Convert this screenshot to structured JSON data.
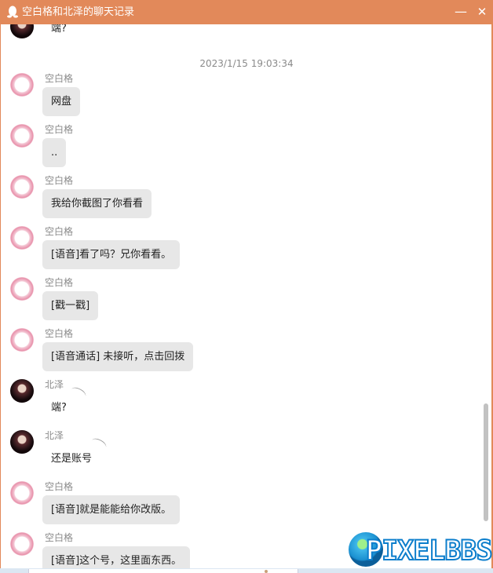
{
  "window": {
    "title": "空白格和北泽的聊天记录",
    "title_icon": "qq-penguin-icon",
    "minimize_label": "—",
    "close_label": "✕",
    "accent_color": "#e2895a"
  },
  "chat": {
    "timestamp": "2023/1/15 19:03:34",
    "top_partial": {
      "text": "端?"
    },
    "messages": [
      {
        "sender": "空白格",
        "text": "网盘",
        "avatar": "pink"
      },
      {
        "sender": "空白格",
        "text": "..",
        "avatar": "pink"
      },
      {
        "sender": "空白格",
        "text": "我给你截图了你看看",
        "avatar": "pink"
      },
      {
        "sender": "空白格",
        "text": "[语音]看了吗？兄你看看。",
        "avatar": "pink"
      },
      {
        "sender": "空白格",
        "text": "[戳一戳]",
        "avatar": "pink"
      },
      {
        "sender": "空白格",
        "text": "[语音通话] 未接听，点击回拨",
        "avatar": "pink"
      },
      {
        "sender": "北泽",
        "text": "端?",
        "avatar": "dark"
      },
      {
        "sender": "北泽",
        "text": "还是账号",
        "avatar": "dark"
      },
      {
        "sender": "空白格",
        "text": "[语音]就是能能给你改版。",
        "avatar": "pink"
      },
      {
        "sender": "空白格",
        "text": "[语音]这个号，这里面东西。",
        "avatar": "pink"
      }
    ]
  },
  "watermark": {
    "text": "PIXELBBS"
  }
}
